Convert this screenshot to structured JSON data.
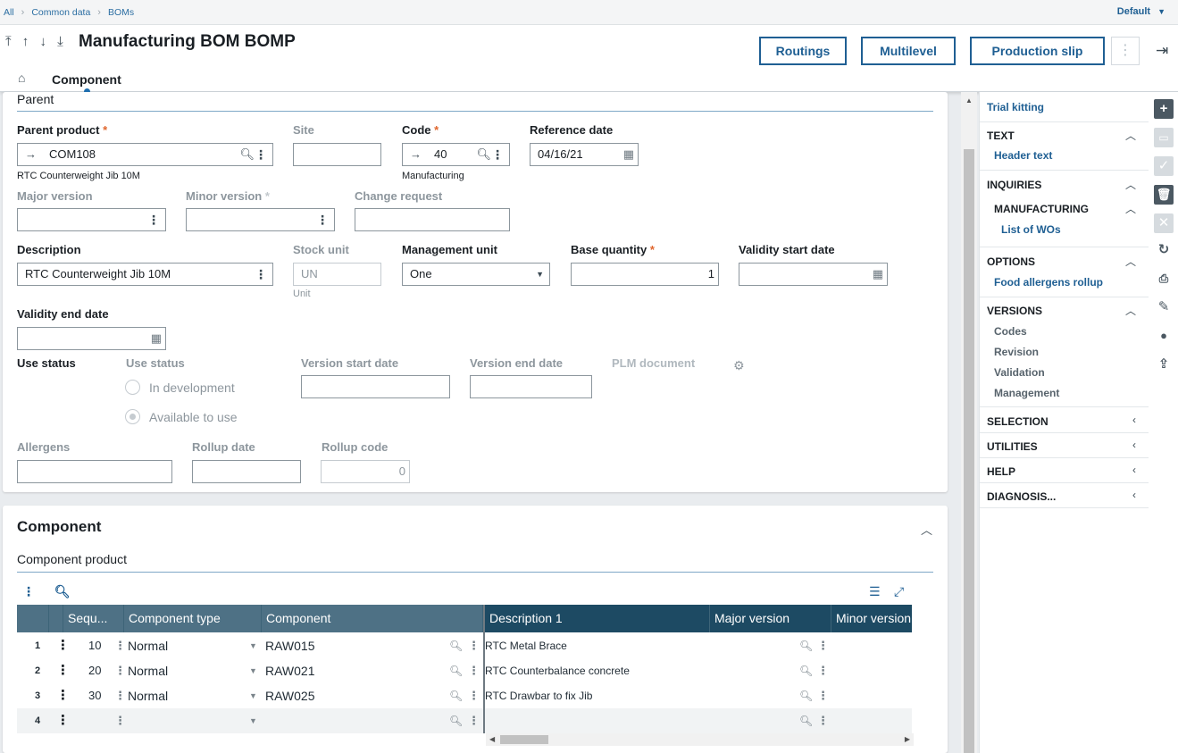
{
  "breadcrumb": {
    "items": [
      "All",
      "Common data",
      "BOMs"
    ],
    "profile": "Default"
  },
  "header": {
    "nav_arrows": "⤒ ↑ ↓ ⤓",
    "title": "Manufacturing BOM BOMP",
    "buttons": {
      "routings": "Routings",
      "multilevel": "Multilevel",
      "production_slip": "Production slip"
    },
    "tab": "Component"
  },
  "parent": {
    "section_title": "Parent",
    "parent_product": {
      "label": "Parent product",
      "value": "COM108",
      "description": "RTC Counterweight Jib 10M"
    },
    "site": {
      "label": "Site",
      "value": ""
    },
    "code": {
      "label": "Code",
      "value": "40",
      "description": "Manufacturing"
    },
    "reference_date": {
      "label": "Reference date",
      "value": "04/16/21"
    },
    "major_version": {
      "label": "Major version",
      "value": ""
    },
    "minor_version": {
      "label": "Minor version",
      "value": ""
    },
    "change_request": {
      "label": "Change request",
      "value": ""
    },
    "description": {
      "label": "Description",
      "value": "RTC Counterweight Jib 10M"
    },
    "stock_unit": {
      "label": "Stock unit",
      "value": "UN",
      "description": "Unit"
    },
    "management_unit": {
      "label": "Management unit",
      "value": "One"
    },
    "base_quantity": {
      "label": "Base quantity",
      "value": "1"
    },
    "validity_start_date": {
      "label": "Validity start date",
      "value": ""
    },
    "validity_end_date": {
      "label": "Validity end date",
      "value": ""
    },
    "use_status_group": "Use status",
    "use_status": {
      "label": "Use status",
      "options": [
        "In development",
        "Available to use"
      ],
      "selected": "Available to use"
    },
    "version_start_date": {
      "label": "Version start date",
      "value": ""
    },
    "version_end_date": {
      "label": "Version end date",
      "value": ""
    },
    "plm_document": {
      "label": "PLM document"
    },
    "allergens": {
      "label": "Allergens",
      "value": ""
    },
    "rollup_date": {
      "label": "Rollup date",
      "value": ""
    },
    "rollup_code": {
      "label": "Rollup code",
      "value": "0"
    }
  },
  "component": {
    "section_title": "Component",
    "subsection_title": "Component product",
    "columns": [
      "Sequ...",
      "Component type",
      "Component",
      "Description 1",
      "Major version",
      "Minor version"
    ],
    "rows": [
      {
        "num": "1",
        "seq": "10",
        "type": "Normal",
        "component": "RAW015",
        "description": "RTC Metal Brace"
      },
      {
        "num": "2",
        "seq": "20",
        "type": "Normal",
        "component": "RAW021",
        "description": "RTC Counterbalance concrete"
      },
      {
        "num": "3",
        "seq": "30",
        "type": "Normal",
        "component": "RAW025",
        "description": "RTC Drawbar to fix Jib"
      },
      {
        "num": "4",
        "seq": "",
        "type": "",
        "component": "",
        "description": ""
      }
    ]
  },
  "side_menu": {
    "trial_kitting": "Trial kitting",
    "text_header": "TEXT",
    "header_text": "Header text",
    "inquiries": "INQUIRIES",
    "manufacturing": "MANUFACTURING",
    "list_of_wos": "List of WOs",
    "options": "OPTIONS",
    "food_allergens": "Food allergens rollup",
    "versions": "VERSIONS",
    "codes": "Codes",
    "revision": "Revision",
    "validation": "Validation",
    "management": "Management",
    "selection": "SELECTION",
    "utilities": "UTILITIES",
    "help": "HELP",
    "diagnosis": "DIAGNOSIS..."
  },
  "colors": {
    "accent": "#1f5f93",
    "required": "#e0662e",
    "grid_header_left": "#4e7185",
    "grid_header_right": "#1d4a63"
  }
}
